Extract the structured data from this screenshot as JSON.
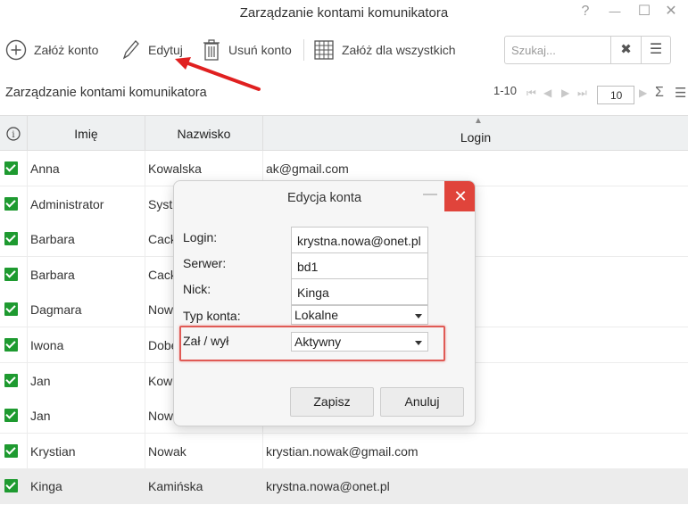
{
  "window": {
    "title": "Zarządzanie kontami komunikatora",
    "help": "?",
    "minimize": "—",
    "maximize": "☐",
    "close": "✕"
  },
  "toolbar": {
    "add_label": "Załóż konto",
    "edit_label": "Edytuj",
    "delete_label": "Usuń konto",
    "add_all_label": "Załóż dla wszystkich",
    "search_placeholder": "Szukaj...",
    "clear_symbol": "✖",
    "menu_symbol": "☰"
  },
  "section": {
    "title": "Zarządzanie kontami komunikatora"
  },
  "pager": {
    "range": "1-10",
    "page_size": "10",
    "sum_symbol": "Σ",
    "menu_symbol": "☰"
  },
  "table": {
    "headers": {
      "info": "i",
      "first_name": "Imię",
      "last_name": "Nazwisko",
      "login": "Login"
    },
    "rows": [
      {
        "first": "Anna",
        "last": "Kowalska",
        "login": "ak@gmail.com"
      },
      {
        "first": "Administrator",
        "last": "Syst",
        "login": ""
      },
      {
        "first": "Barbara",
        "last": "Cack",
        "login": ""
      },
      {
        "first": "Barbara",
        "last": "Cack",
        "login": ""
      },
      {
        "first": "Dagmara",
        "last": "Now",
        "login": ""
      },
      {
        "first": "Iwona",
        "last": "Dobe",
        "login": ""
      },
      {
        "first": "Jan",
        "last": "Kow",
        "login": ""
      },
      {
        "first": "Jan",
        "last": "Now",
        "login": ""
      },
      {
        "first": "Krystian",
        "last": "Nowak",
        "login": "krystian.nowak@gmail.com"
      },
      {
        "first": "Kinga",
        "last": "Kamińska",
        "login": "krystna.nowa@onet.pl"
      }
    ]
  },
  "dialog": {
    "title": "Edycja konta",
    "minimize": "—",
    "close": "✕",
    "login_label": "Login:",
    "login_value": "krystna.nowa@onet.pl",
    "server_label": "Serwer:",
    "server_value": "bd1",
    "nick_label": "Nick:",
    "nick_value": "Kinga",
    "account_type_label": "Typ konta:",
    "account_type_value": "Lokalne",
    "onoff_label": "Zał / wył",
    "onoff_value": "Aktywny",
    "save_label": "Zapisz",
    "cancel_label": "Anuluj"
  },
  "colors": {
    "checkbox": "#1e9a30",
    "highlight": "#e05a55",
    "arrow": "#e02020",
    "close_button": "#e0443b",
    "header_bg": "#eef0f1"
  }
}
